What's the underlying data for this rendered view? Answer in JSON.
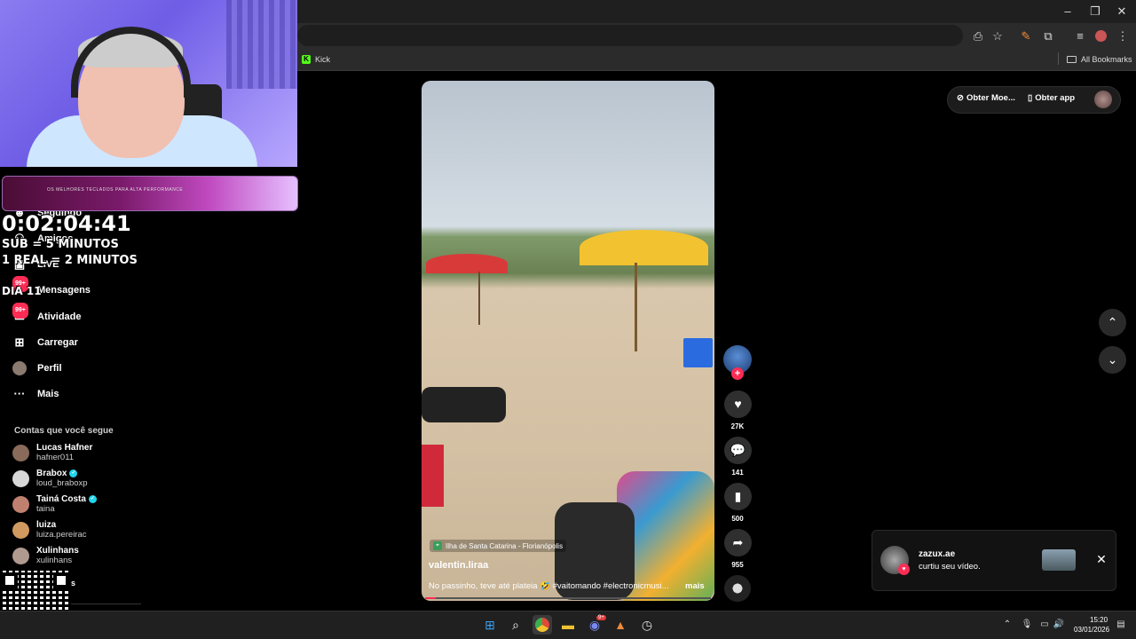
{
  "browser": {
    "bookmark_kick": "Kick",
    "bookmark_kick_logo": "K",
    "all_bookmarks": "All Bookmarks",
    "icons": [
      "install-icon",
      "star-icon",
      "pen-icon",
      "extensions-icon",
      "media-icon",
      "profile-icon",
      "kebab-menu-icon"
    ],
    "window_buttons": [
      "minimize-icon",
      "restore-icon",
      "close-icon"
    ]
  },
  "stream_overlay": {
    "timer": "0:02:04:41",
    "sub_rule": "SUB = 5 MINUTOS",
    "real_rule": "1 REAL = 2 MINUTOS",
    "day": "DIA 11",
    "promo_text": "OS MELHORES TECLADOS PARA ALTA PERFORMANCE"
  },
  "sidebar": {
    "items": [
      {
        "label": "Seguindo",
        "icon": "following-icon"
      },
      {
        "label": "Amigos",
        "icon": "friends-icon"
      },
      {
        "label": "LIVE",
        "icon": "live-icon"
      },
      {
        "label": "Mensagens",
        "icon": "messages-icon",
        "badge": "99+"
      },
      {
        "label": "Atividade",
        "icon": "activity-icon",
        "badge": "99+"
      },
      {
        "label": "Carregar",
        "icon": "upload-icon"
      },
      {
        "label": "Perfil",
        "icon": "profile-icon"
      },
      {
        "label": "Mais",
        "icon": "more-icon"
      }
    ],
    "following_title": "Contas que você segue",
    "accounts": [
      {
        "name": "Lucas Hafner",
        "user": "hafner011",
        "verified": false,
        "color": "#8a6a5a"
      },
      {
        "name": "Brabox",
        "user": "loud_braboxp",
        "verified": true,
        "color": "#d8d8d8"
      },
      {
        "name": "Tainá Costa",
        "user": "taina",
        "verified": true,
        "color": "#c08070"
      },
      {
        "name": "luiza",
        "user": "luiza.pereirac",
        "verified": false,
        "color": "#d09a60"
      },
      {
        "name": "Xulinhans",
        "user": "xulinhans",
        "verified": false,
        "color": "#b09a90"
      }
    ],
    "last_item_suffix": "s"
  },
  "video": {
    "location": "Ilha de Santa Catarina - Florianópolis",
    "author": "valentin.liraa",
    "caption": "No passinho, teve até plateia 🤣 #vaitomando #electronicmusi...",
    "more": "mais",
    "colors": {
      "umbrella_red": "#d83a3a",
      "umbrella_yellow": "#f2c230",
      "cooler": "#2a6be0"
    }
  },
  "actions": {
    "likes": "27K",
    "comments": "141",
    "saves": "500",
    "shares": "955"
  },
  "top_right": {
    "coins": "Obter Moe...",
    "get_app": "Obter app"
  },
  "notification": {
    "user": "zazux.ae",
    "text": "curtiu seu vídeo."
  },
  "taskbar": {
    "time": "15:20",
    "date": "03/01/2026",
    "chrome_badge": "",
    "discord_badge": "9+"
  }
}
